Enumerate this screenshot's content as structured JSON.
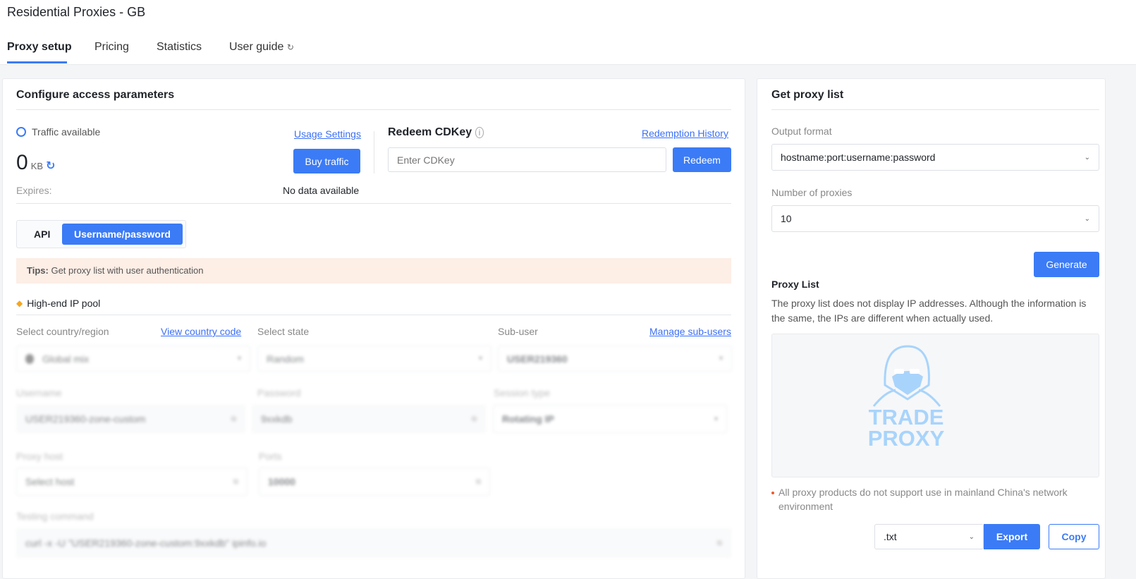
{
  "header": {
    "title": "Residential Proxies - GB",
    "tabs": [
      {
        "label": "Proxy setup",
        "active": true
      },
      {
        "label": "Pricing"
      },
      {
        "label": "Statistics"
      },
      {
        "label": "User guide",
        "icon": "external-link-icon"
      }
    ]
  },
  "config": {
    "title": "Configure access parameters",
    "traffic_label": "Traffic available",
    "usage_settings": "Usage Settings",
    "traffic_value": "0",
    "traffic_unit": "KB",
    "buy_traffic": "Buy traffic",
    "expires_label": "Expires:",
    "expires_value": "No data available",
    "redeem": {
      "title": "Redeem CDKey",
      "history": "Redemption History",
      "placeholder": "Enter CDKey",
      "button": "Redeem"
    },
    "auth_tabs": [
      {
        "label": "API"
      },
      {
        "label": "Username/password",
        "active": true
      }
    ],
    "tips_label": "Tips:",
    "tips_text": "Get proxy list with user authentication",
    "pool_label": "High-end IP pool",
    "country_label": "Select country/region",
    "view_country_code": "View country code",
    "country_value": "Global mix",
    "state_label": "Select state",
    "state_value": "Random",
    "subuser_label": "Sub-user",
    "manage_subusers": "Manage sub-users",
    "subuser_value": "USER219360",
    "username_label": "Username",
    "username_value": "USER219360-zone-custom",
    "password_label": "Password",
    "password_value": "9xxkdb",
    "session_label": "Session type",
    "session_value": "Rotating IP",
    "host_label": "Proxy host",
    "host_value": "Select host",
    "ports_label": "Ports",
    "ports_value": "10000",
    "testing_label": "Testing command",
    "testing_value": "curl -x  -U \"USER219360-zone-custom:9xxkdb\" ipinfo.io"
  },
  "proxy_list": {
    "title": "Get proxy list",
    "format_label": "Output format",
    "format_value": "hostname:port:username:password",
    "count_label": "Number of proxies",
    "count_value": "10",
    "generate": "Generate",
    "list_title": "Proxy List",
    "note": "The proxy list does not display IP addresses. Although the information is the same, the IPs are different when actually used.",
    "logo_text": "TRADE PROXY",
    "warning": "All proxy products do not support use in mainland China's network environment",
    "export_format": ".txt",
    "export": "Export",
    "copy": "Copy"
  },
  "colors": {
    "accent": "#3b7bf6",
    "tips_bg": "#fdeee6",
    "logo": "#a8d4fb"
  }
}
